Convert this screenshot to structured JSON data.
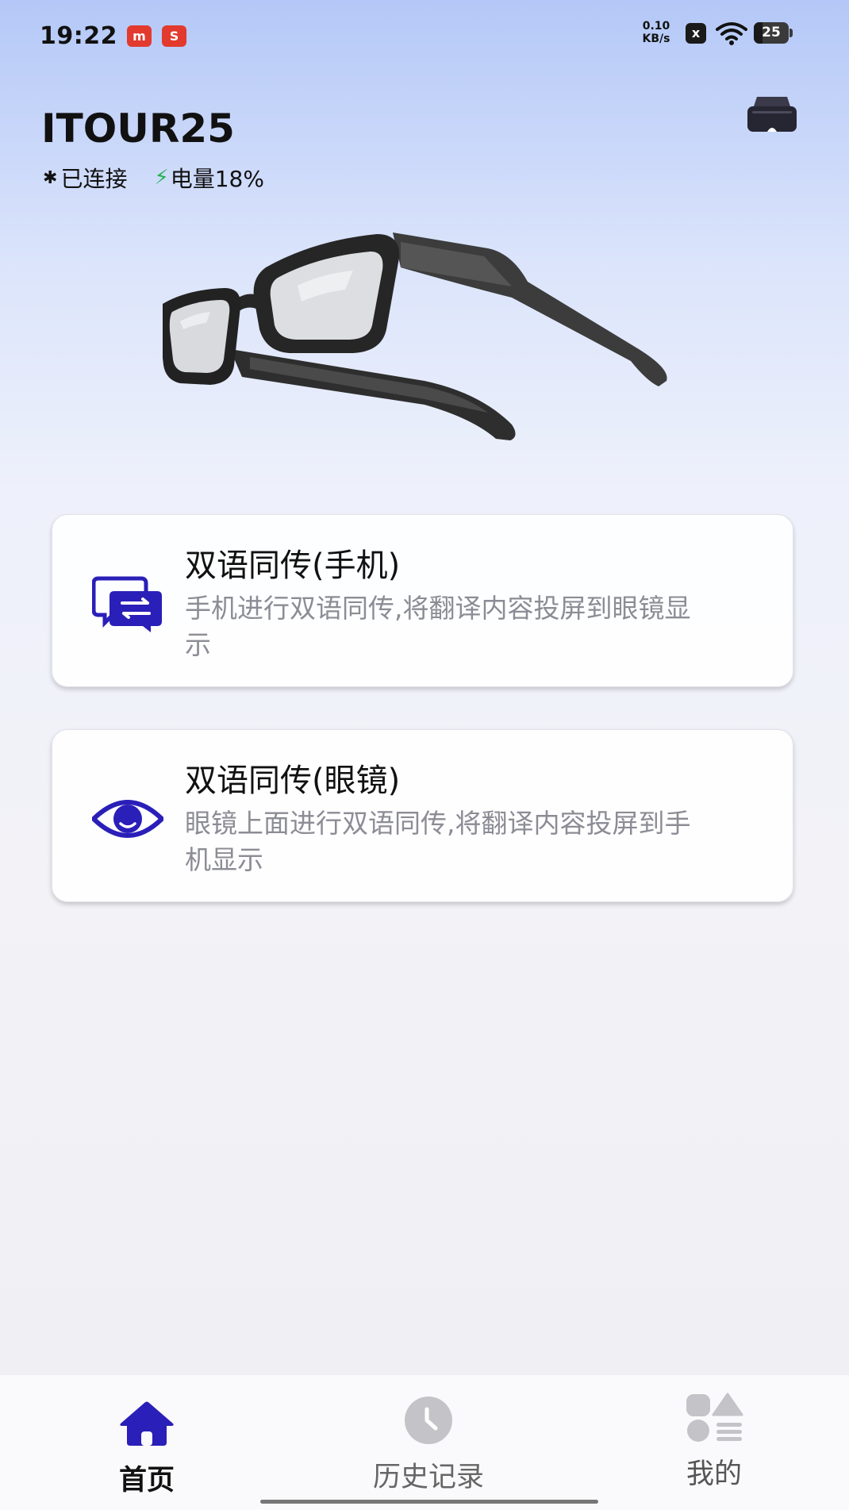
{
  "status_bar": {
    "time": "19:22",
    "app_badges": [
      "m",
      "S"
    ],
    "net_speed_value": "0.10",
    "net_speed_unit": "KB/s",
    "sim_label": "x",
    "battery_level": "25",
    "battery_fraction": 0.25
  },
  "device": {
    "name": "ITOUR25",
    "connection_status": "已连接",
    "battery_text": "电量18%",
    "bluetooth_icon": "bluetooth-icon",
    "bolt_icon": "charging-bolt-icon",
    "headset_icon": "vr-glasses-icon"
  },
  "cards": [
    {
      "title": "双语同传(手机)",
      "description": "手机进行双语同传,将翻译内容投屏到眼镜显示",
      "icon": "chat-translate-icon"
    },
    {
      "title": "双语同传(眼镜)",
      "description": "眼镜上面进行双语同传,将翻译内容投屏到手机显示",
      "icon": "eye-icon"
    }
  ],
  "tab_bar": {
    "tabs": [
      {
        "label": "首页",
        "icon": "home-icon",
        "active": true
      },
      {
        "label": "历史记录",
        "icon": "clock-icon",
        "active": false
      },
      {
        "label": "我的",
        "icon": "grid-icon",
        "active": false
      }
    ]
  },
  "colors": {
    "accent": "#2a1fb8",
    "charging": "#22b14c",
    "inactive_icon": "#c4c4c8",
    "description_text": "#8c8c95"
  }
}
